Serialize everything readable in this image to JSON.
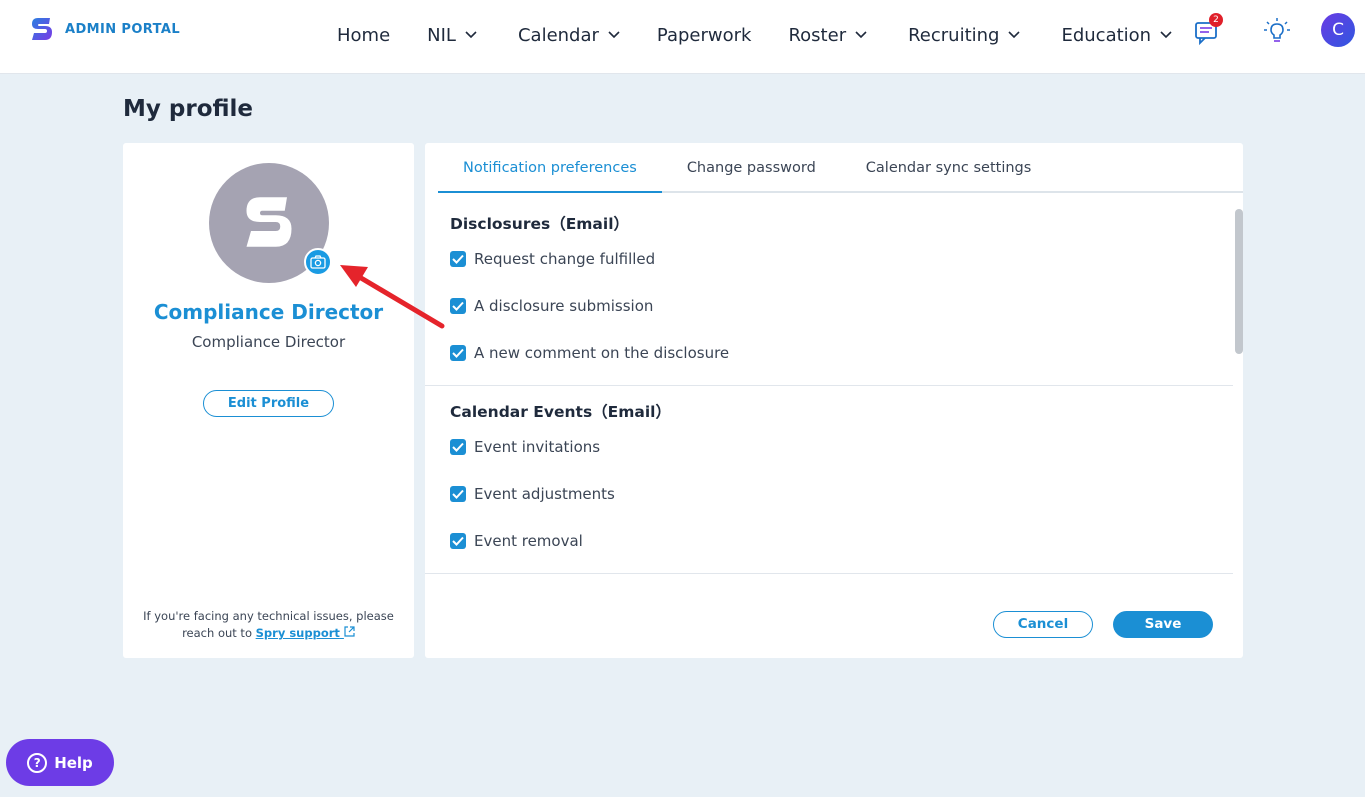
{
  "header": {
    "logo_text": "ADMIN PORTAL",
    "nav": [
      {
        "label": "Home",
        "dropdown": false
      },
      {
        "label": "NIL",
        "dropdown": true
      },
      {
        "label": "Calendar",
        "dropdown": true
      },
      {
        "label": "Paperwork",
        "dropdown": false
      },
      {
        "label": "Roster",
        "dropdown": true
      },
      {
        "label": "Recruiting",
        "dropdown": true
      },
      {
        "label": "Education",
        "dropdown": true
      }
    ],
    "messages_badge": "2",
    "user_initial": "C"
  },
  "page": {
    "title": "My profile"
  },
  "profile": {
    "name": "Compliance Director",
    "role": "Compliance Director",
    "edit_label": "Edit Profile",
    "support_text": "If you're facing any technical issues, please reach out to",
    "support_link": "Spry support"
  },
  "tabs": [
    {
      "label": "Notification preferences",
      "active": true
    },
    {
      "label": "Change password",
      "active": false
    },
    {
      "label": "Calendar sync settings",
      "active": false
    }
  ],
  "sections": [
    {
      "title": "Disclosures（Email）",
      "options": [
        {
          "label": "Request change fulfilled",
          "checked": true
        },
        {
          "label": "A disclosure submission",
          "checked": true
        },
        {
          "label": "A new comment on the disclosure",
          "checked": true
        }
      ]
    },
    {
      "title": "Calendar Events（Email）",
      "options": [
        {
          "label": "Event invitations",
          "checked": true
        },
        {
          "label": "Event adjustments",
          "checked": true
        },
        {
          "label": "Event removal",
          "checked": true
        }
      ]
    }
  ],
  "actions": {
    "cancel_label": "Cancel",
    "save_label": "Save"
  },
  "help": {
    "label": "Help"
  },
  "colors": {
    "accent": "#1b8fd4",
    "help": "#6d3ce6",
    "annotation": "#e5242b"
  }
}
